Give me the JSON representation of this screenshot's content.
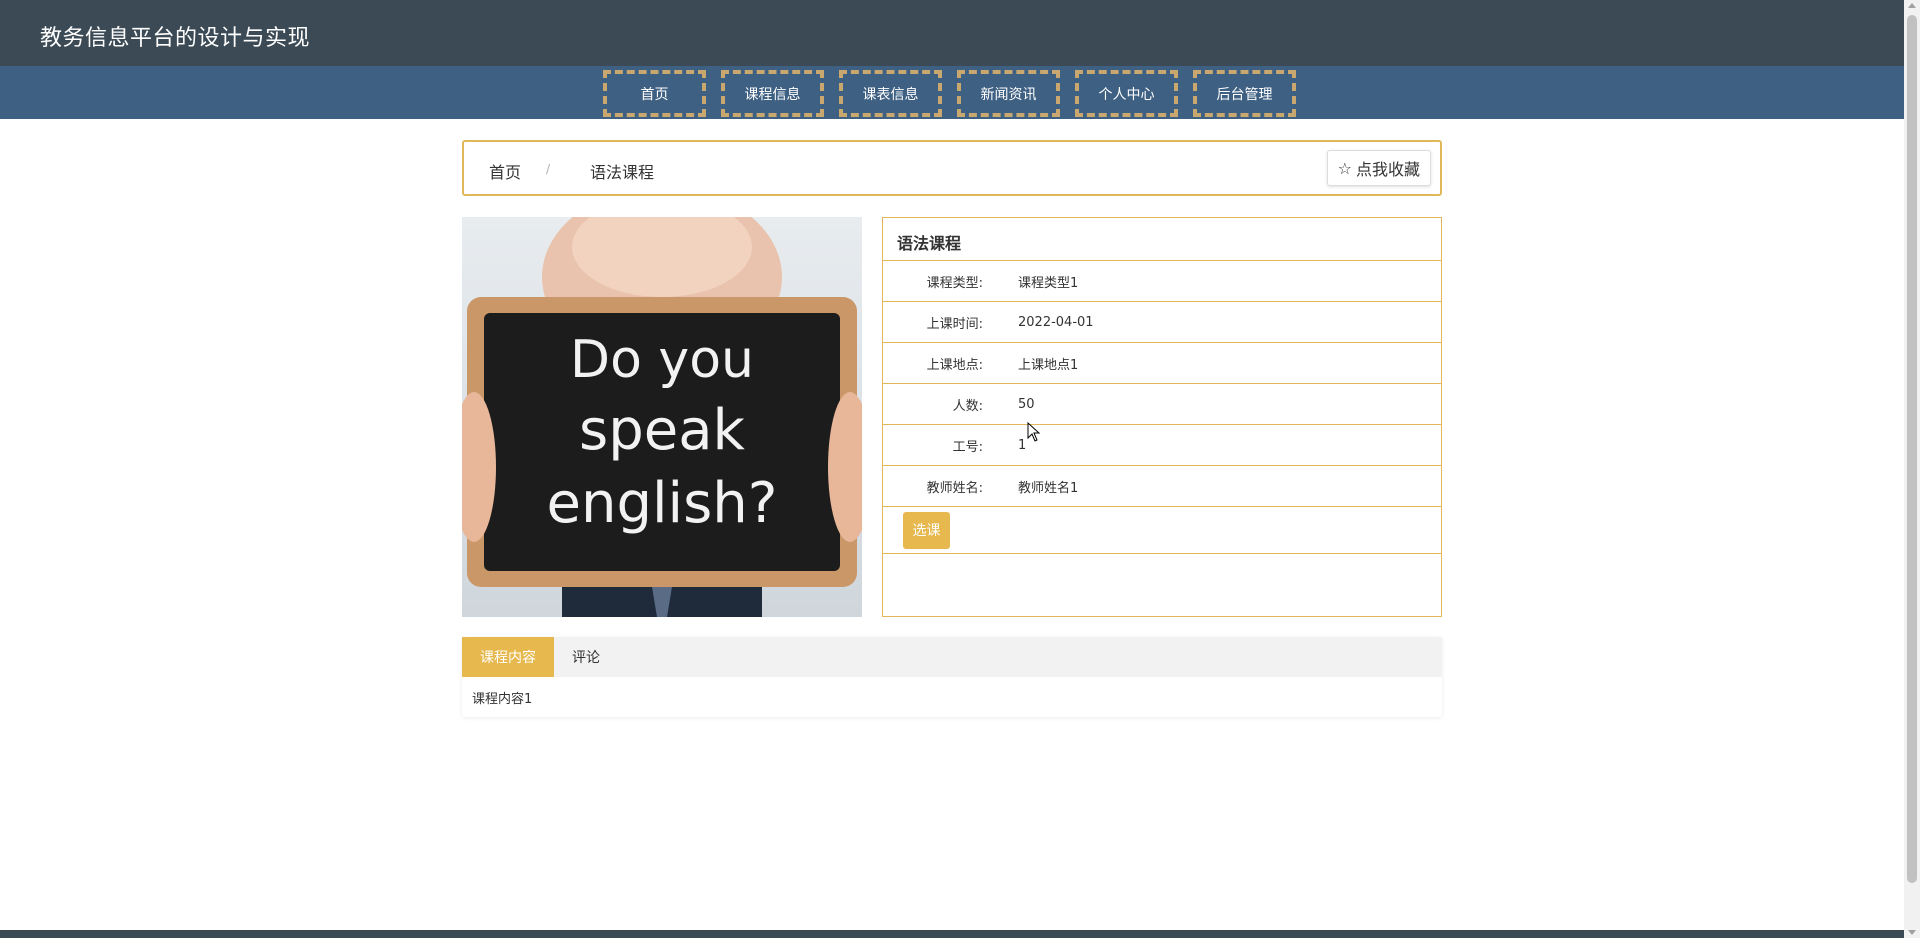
{
  "site": {
    "title": "教务信息平台的设计与实现"
  },
  "nav": {
    "items": [
      "首页",
      "课程信息",
      "课表信息",
      "新闻资讯",
      "个人中心",
      "后台管理"
    ]
  },
  "breadcrumb": {
    "home": "首页",
    "separator": "/",
    "current": "语法课程",
    "favorite_label": "点我收藏",
    "favorite_icon": "star-outline-icon"
  },
  "course": {
    "image_alt": "Do you speak english?",
    "image_text": [
      "Do you",
      "speak",
      "english?"
    ],
    "title": "语法课程",
    "fields": [
      {
        "label": "课程类型:",
        "value": "课程类型1"
      },
      {
        "label": "上课时间:",
        "value": "2022-04-01"
      },
      {
        "label": "上课地点:",
        "value": "上课地点1"
      },
      {
        "label": "人数:",
        "value": "50"
      },
      {
        "label": "工号:",
        "value": "1"
      },
      {
        "label": "教师姓名:",
        "value": "教师姓名1"
      }
    ],
    "select_button": "选课"
  },
  "tabs": {
    "items": [
      "课程内容",
      "评论"
    ],
    "active": 0,
    "content": "课程内容1"
  },
  "colors": {
    "header": "#3b4a55",
    "nav": "#3e6083",
    "accent": "#e6b84d",
    "border": "#e0b85a"
  }
}
